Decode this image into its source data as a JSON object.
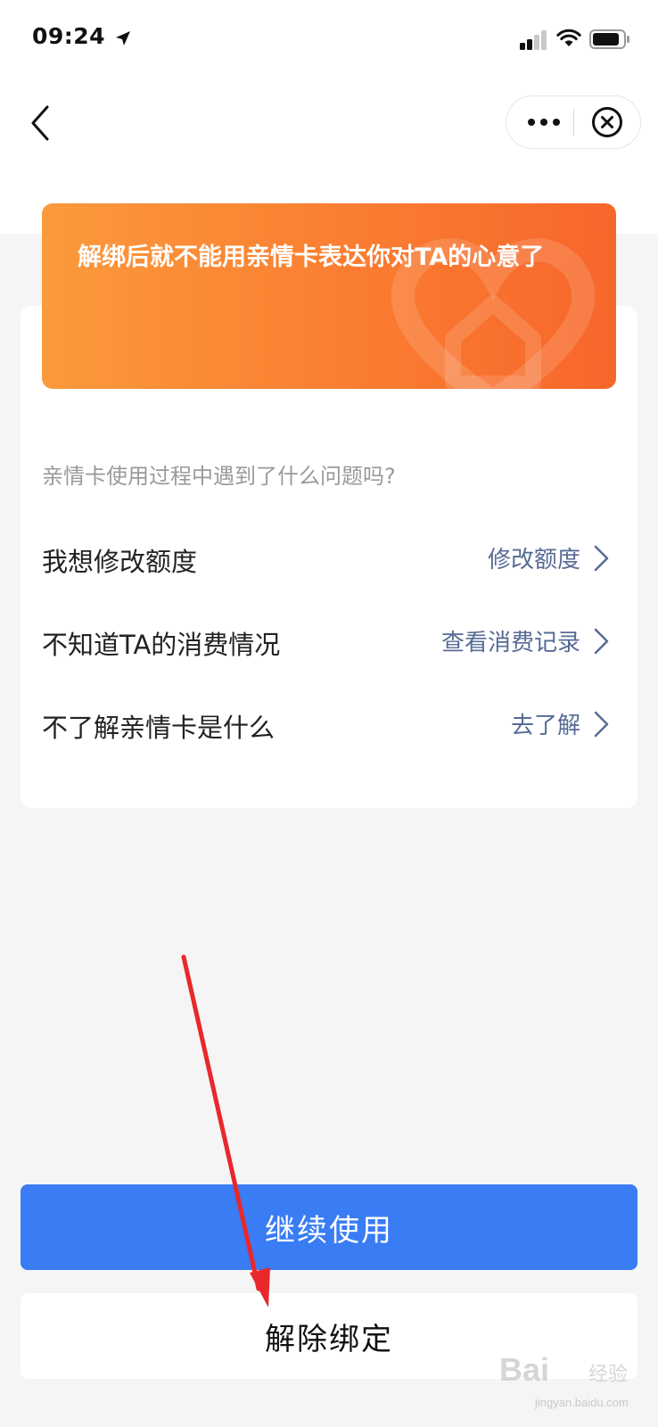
{
  "status_bar": {
    "time": "09:24"
  },
  "banner": {
    "text": "解绑后就不能用亲情卡表达你对TA的心意了"
  },
  "question": "亲情卡使用过程中遇到了什么问题吗?",
  "rows": [
    {
      "label": "我想修改额度",
      "action": "修改额度"
    },
    {
      "label": "不知道TA的消费情况",
      "action": "查看消费记录"
    },
    {
      "label": "不了解亲情卡是什么",
      "action": "去了解"
    }
  ],
  "buttons": {
    "continue": "继续使用",
    "unbind": "解除绑定"
  },
  "watermark": {
    "brand": "Bai",
    "cn": "经验",
    "url": "jingyan.baidu.com"
  },
  "colors": {
    "primary": "#3a7cf4",
    "link": "#576b95",
    "banner_start": "#fb9a3c",
    "banner_end": "#f7662b",
    "annotation_arrow": "#e8282b"
  },
  "icons": {
    "location": "location-arrow-icon",
    "signal": "cellular-signal-icon",
    "wifi": "wifi-icon",
    "battery": "battery-icon",
    "back": "chevron-left-icon",
    "more": "more-dots-icon",
    "close": "close-circle-icon",
    "row_chevron": "chevron-right-icon"
  }
}
